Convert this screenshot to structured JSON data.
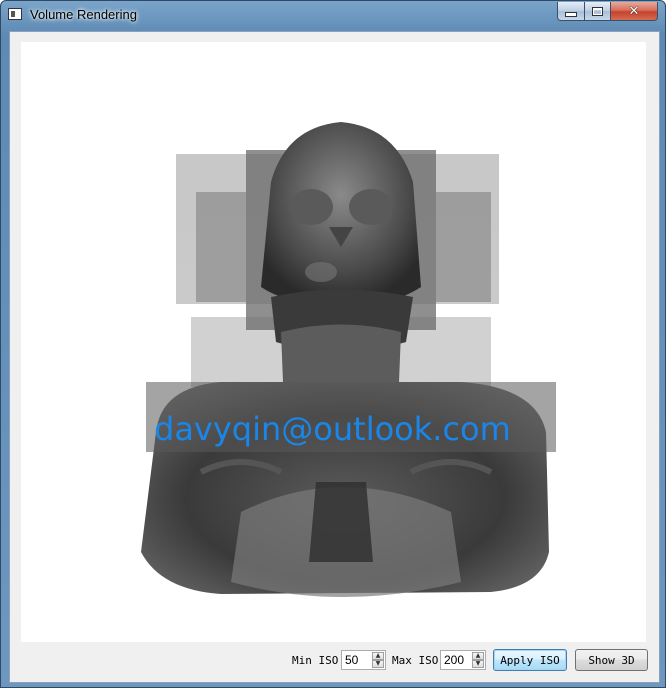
{
  "window": {
    "title": "Volume Rendering",
    "controls": {
      "minimize": "—",
      "maximize": "□",
      "close": "✕"
    }
  },
  "viewport": {
    "watermark": "davyqin@outlook.com",
    "watermark_color": "#1a86e8"
  },
  "controls": {
    "min_iso_label": "Min ISO",
    "min_iso_value": "50",
    "max_iso_label": "Max ISO",
    "max_iso_value": "200",
    "apply_label": "Apply ISO",
    "show3d_label": "Show 3D"
  },
  "icons": [
    "app-icon",
    "minimize-icon",
    "maximize-icon",
    "close-icon",
    "spin-up-icon",
    "spin-down-icon"
  ]
}
